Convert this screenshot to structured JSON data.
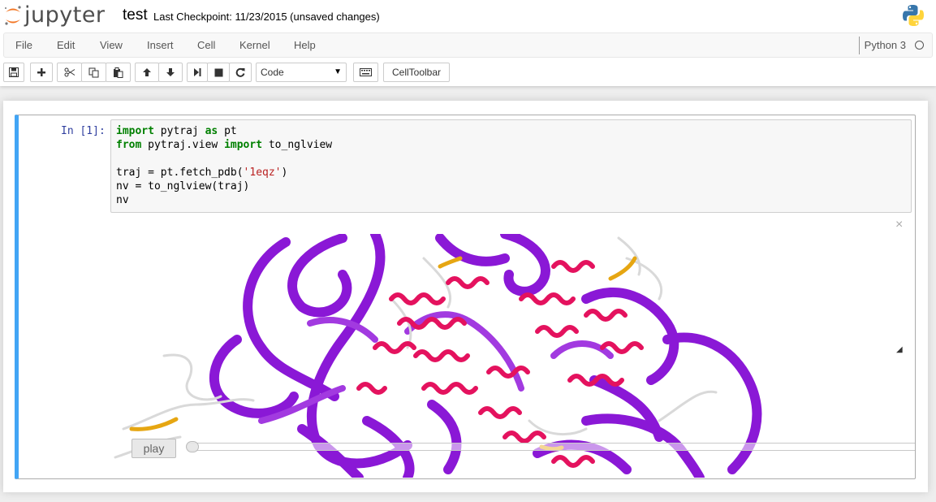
{
  "header": {
    "logo_text": "jupyter",
    "notebook_name": "test",
    "checkpoint": "Last Checkpoint: 11/23/2015 (unsaved changes)",
    "brand_color": "#f37726"
  },
  "menubar": {
    "items": [
      "File",
      "Edit",
      "View",
      "Insert",
      "Cell",
      "Kernel",
      "Help"
    ],
    "kernel_name": "Python 3"
  },
  "toolbar": {
    "icons": [
      "save-icon",
      "plus-icon",
      "cut-icon",
      "copy-icon",
      "paste-icon",
      "arrow-up-icon",
      "arrow-down-icon",
      "step-forward-icon",
      "stop-icon",
      "refresh-icon",
      "keyboard-icon"
    ],
    "cell_type": "Code",
    "celltoolbar_label": "CellToolbar"
  },
  "cell": {
    "prompt": "In [1]:",
    "code": {
      "l1_kw1": "import",
      "l1_a": " pytraj ",
      "l1_kw2": "as",
      "l1_b": " pt",
      "l2_kw1": "from",
      "l2_a": " pytraj.view ",
      "l2_kw2": "import",
      "l2_b": " to_nglview",
      "l4_a": "traj = pt.fetch_pdb(",
      "l4_str": "'1eqz'",
      "l4_b": ")",
      "l5": "nv = to_nglview(traj)",
      "l6": "nv"
    },
    "accent_color": "#42a5f5"
  },
  "output": {
    "close_symbol": "×",
    "play_label": "play",
    "frame_position": 0.0,
    "colors": {
      "sheet": "#8a18d6",
      "helix": "#e4125e",
      "coil": "#d9d9d9",
      "turn": "#e6a612"
    }
  }
}
